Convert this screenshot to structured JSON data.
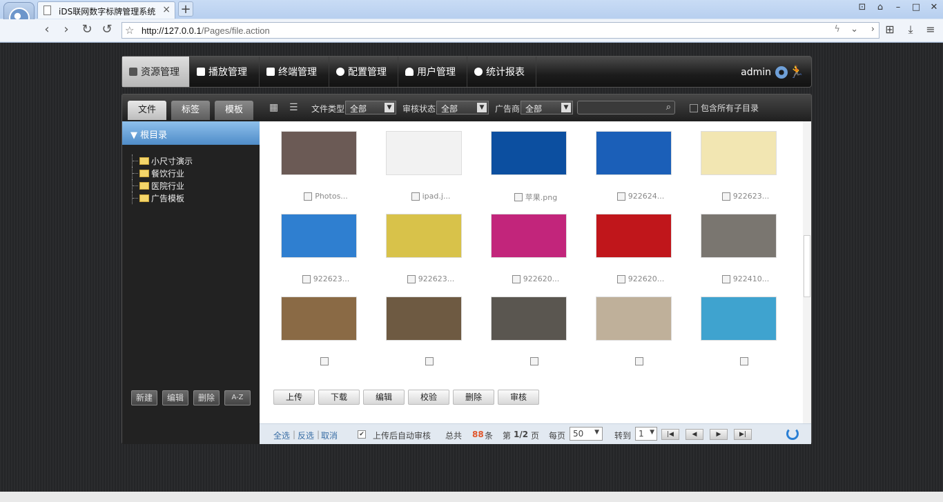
{
  "browser": {
    "tab_title": "iDS联网数字标牌管理系统",
    "tab_close": "×",
    "new_tab": "+",
    "url_host": "http://127.0.0.1",
    "url_path": "/Pages/file.action"
  },
  "nav": {
    "items": [
      {
        "label": "资源管理",
        "icon": "file-icon"
      },
      {
        "label": "播放管理",
        "icon": "film-icon"
      },
      {
        "label": "终端管理",
        "icon": "laptop-icon"
      },
      {
        "label": "配置管理",
        "icon": "gear-icon"
      },
      {
        "label": "用户管理",
        "icon": "user-icon"
      },
      {
        "label": "统计报表",
        "icon": "chart-icon"
      }
    ],
    "user": "admin"
  },
  "left_tabs": [
    "文件",
    "标签",
    "模板"
  ],
  "filters": {
    "file_type_label": "文件类型",
    "file_type_value": "全部",
    "review_label": "审核状态",
    "review_value": "全部",
    "advertiser_label": "广告商",
    "advertiser_value": "全部",
    "include_sub_label": "包含所有子目录"
  },
  "sidebar": {
    "root": "根目录",
    "folders": [
      "小尺寸演示",
      "餐饮行业",
      "医院行业",
      "广告模板"
    ],
    "buttons": [
      "新建",
      "编辑",
      "删除",
      "A-Z"
    ]
  },
  "files": [
    {
      "name": "Photos...",
      "color": "#6b5a55"
    },
    {
      "name": "ipad.j...",
      "color": "#f2f2f2"
    },
    {
      "name": "苹果.png",
      "color": "#0c4fa0"
    },
    {
      "name": "922624...",
      "color": "#1b5fb8"
    },
    {
      "name": "922623...",
      "color": "#f2e6b2"
    },
    {
      "name": "922623...",
      "color": "#2f7fd0"
    },
    {
      "name": "922623...",
      "color": "#d8c24a"
    },
    {
      "name": "922620...",
      "color": "#c2257b"
    },
    {
      "name": "922620...",
      "color": "#c0161b"
    },
    {
      "name": "922410...",
      "color": "#7a7670"
    },
    {
      "name": "",
      "color": "#8a6a45"
    },
    {
      "name": "",
      "color": "#6e5a42"
    },
    {
      "name": "",
      "color": "#5a5650"
    },
    {
      "name": "",
      "color": "#bfb09a"
    },
    {
      "name": "",
      "color": "#3fa3cf"
    }
  ],
  "actions": [
    "上传",
    "下载",
    "编辑",
    "校验",
    "删除",
    "审核"
  ],
  "footer": {
    "select_all": "全选",
    "invert": "反选",
    "cancel": "取消",
    "auto_review": "上传后自动审核",
    "total_prefix": "总共",
    "total_count": "88",
    "total_suffix": "条",
    "page_prefix": "第",
    "page_value": "1/2",
    "page_suffix": "页",
    "per_page_label": "每页",
    "per_page_value": "50",
    "goto_label": "转到",
    "goto_value": "1"
  }
}
